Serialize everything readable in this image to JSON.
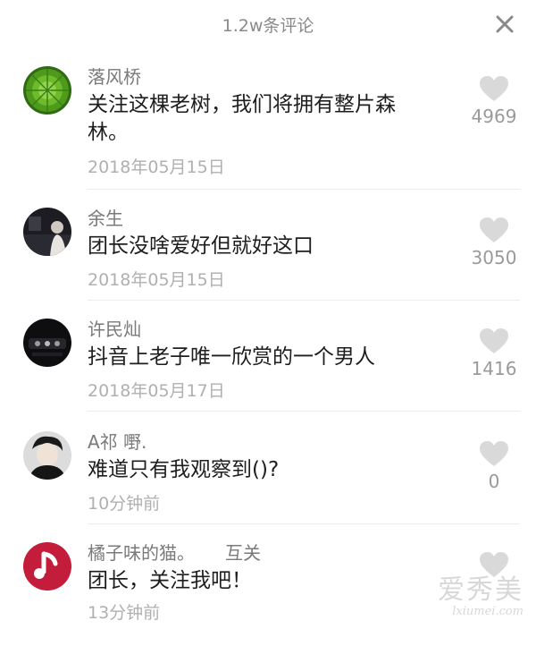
{
  "header": {
    "title": "1.2w条评论",
    "close_icon": "close-icon"
  },
  "comments": [
    {
      "username": "落风桥",
      "text": "关注这棵老树，我们将拥有整片森林。",
      "date": "2018年05月15日",
      "likes": "4969",
      "avatar_icon": "succulent-plant-avatar"
    },
    {
      "username": "余生",
      "text": "团长没啥爱好但就好这口",
      "date": "2018年05月15日",
      "likes": "3050",
      "avatar_icon": "person-avatar"
    },
    {
      "username": "许民灿",
      "text": "抖音上老子唯一欣赏的一个男人",
      "date": "2018年05月17日",
      "likes": "1416",
      "avatar_icon": "car-interior-avatar"
    },
    {
      "username": "A祁 嘢.",
      "text": "难道只有我观察到()?",
      "date": "10分钟前",
      "likes": "0",
      "avatar_icon": "person-avatar"
    },
    {
      "username": "橘子味的猫。",
      "follow_tag": "互关",
      "text": "团长，关注我吧！",
      "date": "13分钟前",
      "likes": "",
      "avatar_icon": "music-note-avatar"
    }
  ],
  "watermark": {
    "text": "爱秀美",
    "url": "lxiumei.com"
  },
  "colors": {
    "like_icon": "#d9d9d9",
    "username": "#7a7a7a",
    "date": "#b0b0b0",
    "text": "#1e1e1e"
  }
}
